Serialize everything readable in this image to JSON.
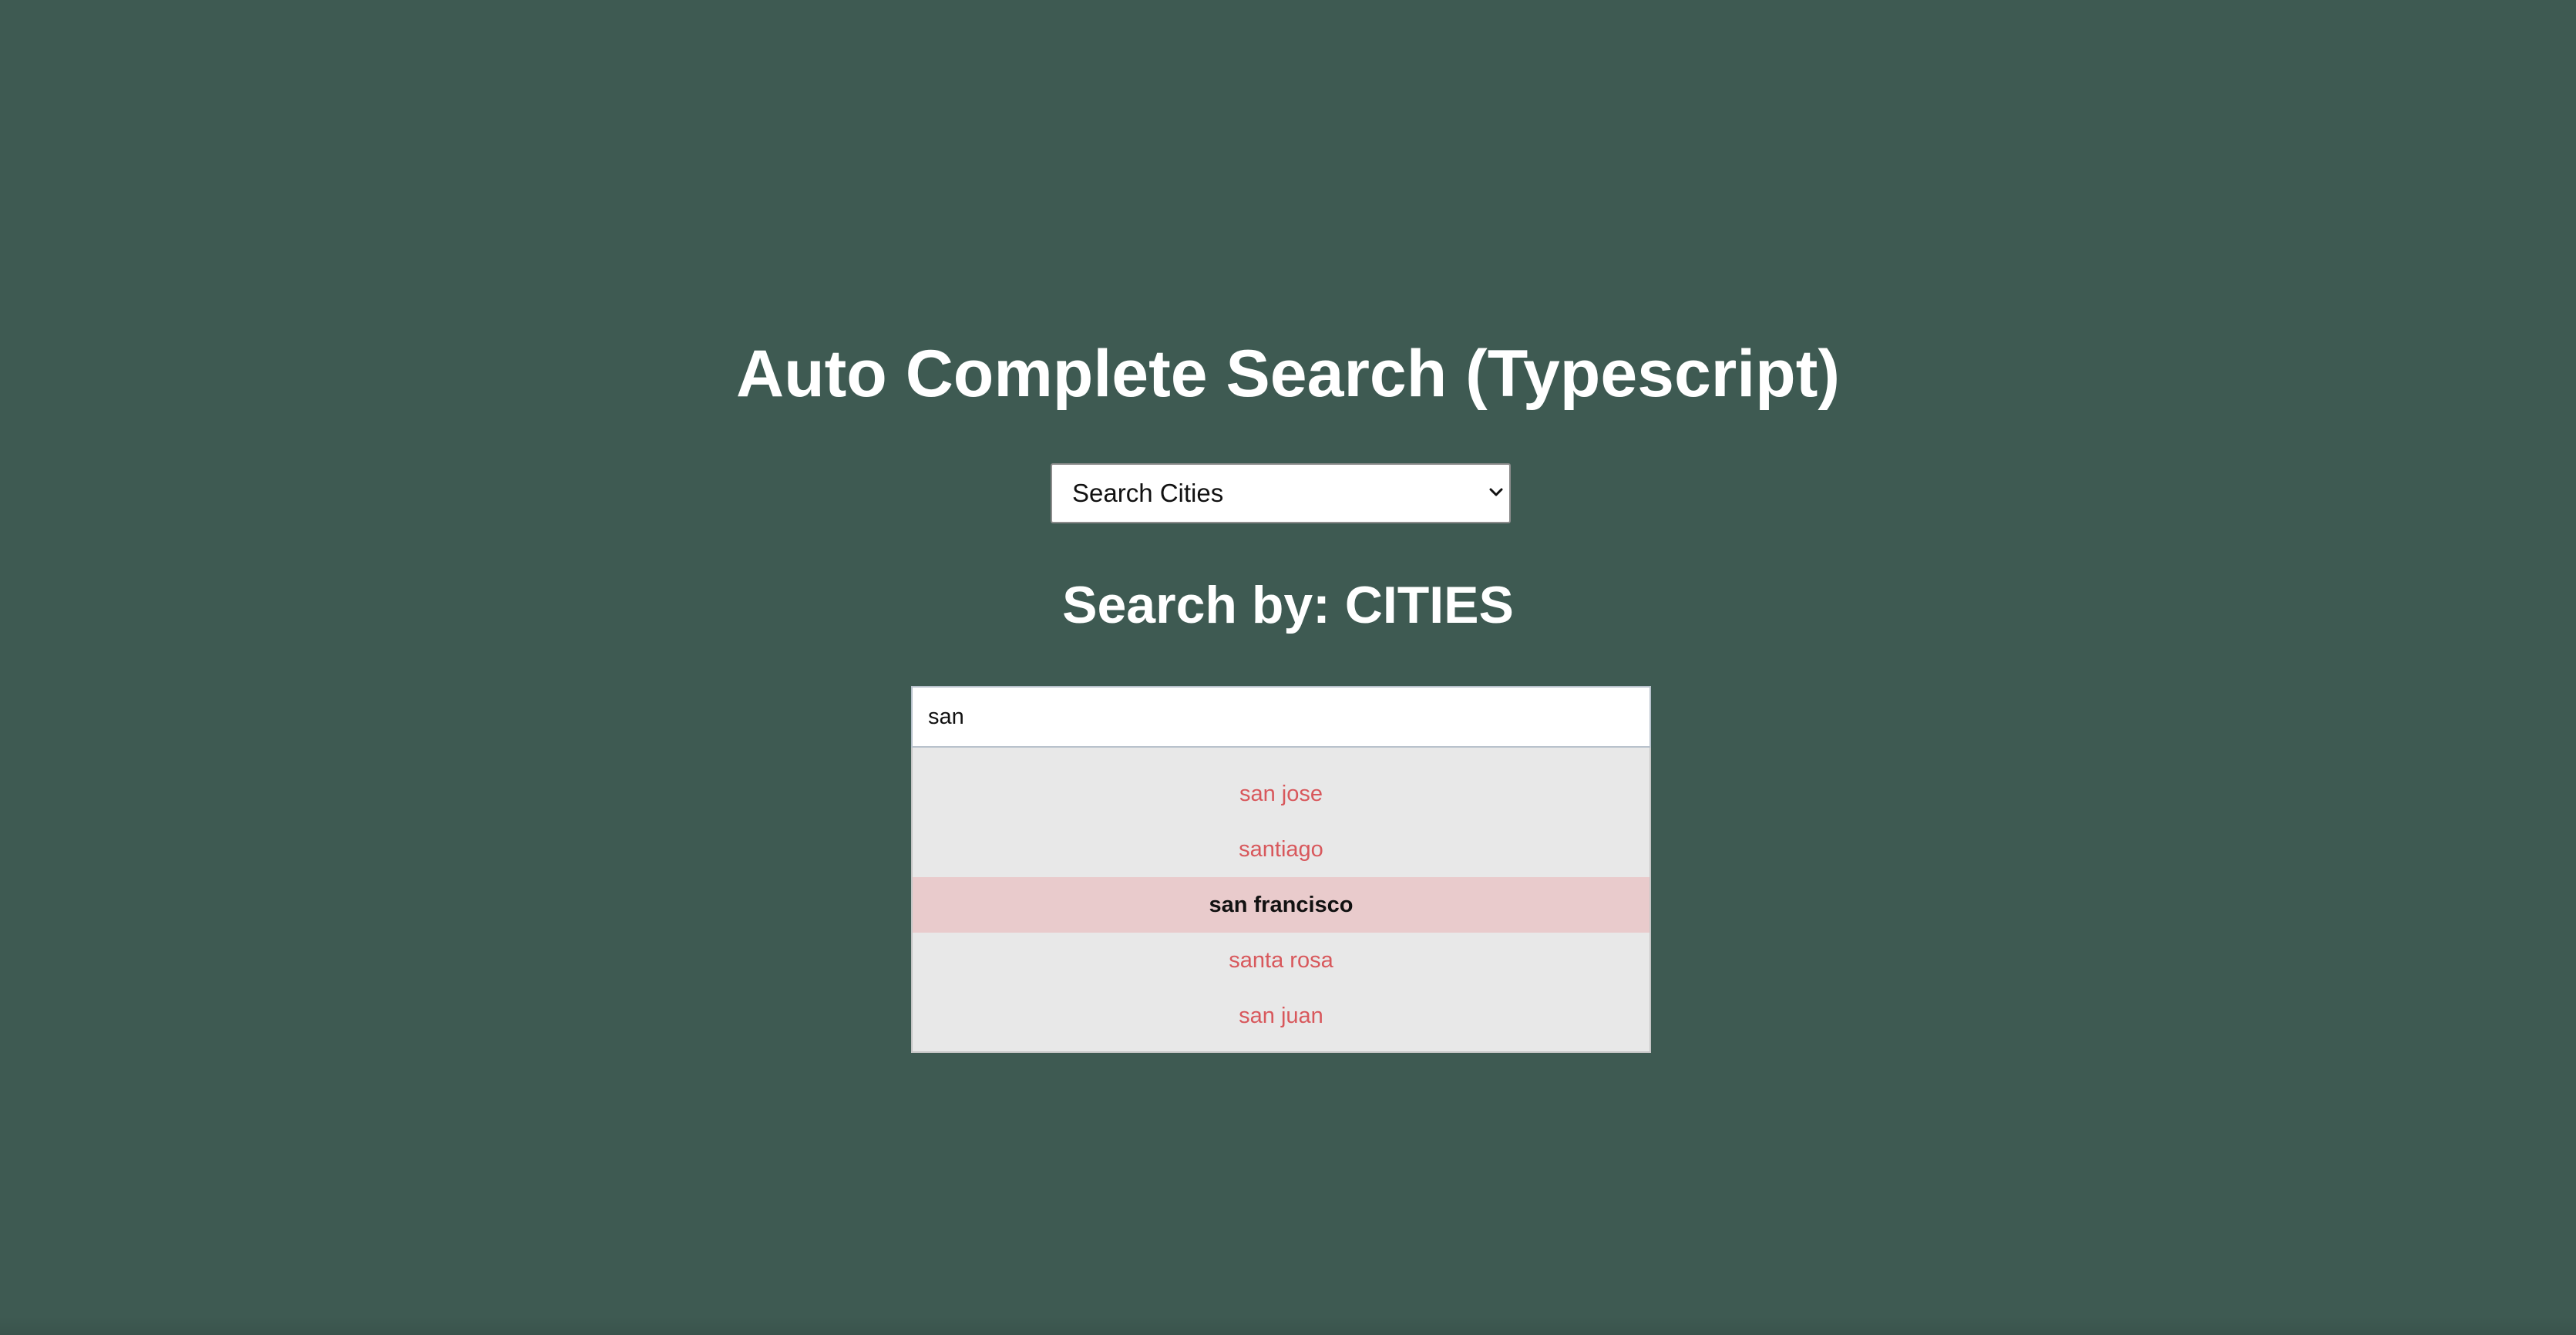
{
  "page": {
    "title": "Auto Complete Search (Typescript)",
    "background_color": "#3e5a52"
  },
  "category_select": {
    "selected": "Search Cities",
    "chevron_icon": "chevron-down-icon"
  },
  "search_section": {
    "heading": "Search by: CITIES",
    "input_value": "san"
  },
  "suggestions": {
    "items": [
      {
        "label": "san jose",
        "highlighted": false
      },
      {
        "label": "santiago",
        "highlighted": false
      },
      {
        "label": "san francisco",
        "highlighted": true
      },
      {
        "label": "santa rosa",
        "highlighted": false
      },
      {
        "label": "san juan",
        "highlighted": false
      }
    ],
    "text_color": "#d8585c",
    "highlight_background": "#e9cbcc",
    "list_background": "#e8e8e8"
  }
}
